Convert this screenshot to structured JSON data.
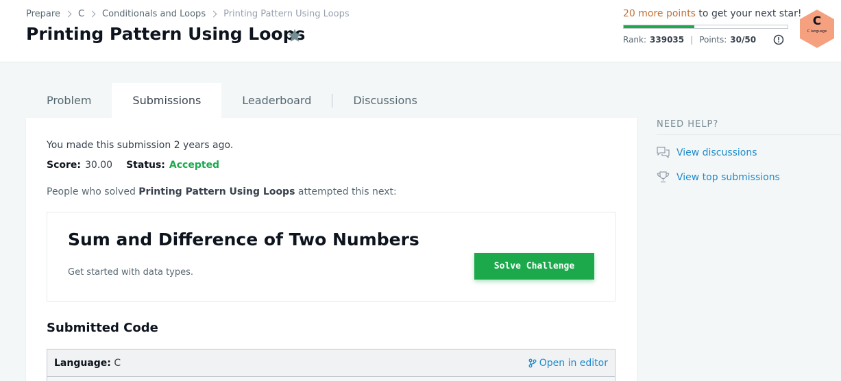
{
  "breadcrumb": [
    "Prepare",
    "C",
    "Conditionals and Loops",
    "Printing Pattern Using Loops"
  ],
  "page_title": "Printing Pattern Using Loops",
  "progress": {
    "points_needed": "20 more points",
    "points_suffix": " to get your next star!",
    "fraction": 0.43
  },
  "rank": {
    "label": "Rank:",
    "value": "339035"
  },
  "points": {
    "label": "Points:",
    "value": "30/50"
  },
  "badge": {
    "letter": "C",
    "sub": "C language"
  },
  "tabs": [
    {
      "label": "Problem"
    },
    {
      "label": "Submissions"
    },
    {
      "label": "Leaderboard"
    },
    {
      "label": "Discussions"
    }
  ],
  "submission": {
    "made": "You made this submission 2 years ago.",
    "score_label": "Score:",
    "score_value": "30.00",
    "status_label": "Status:",
    "status_value": "Accepted",
    "people_prefix": "People who solved ",
    "people_bold": "Printing Pattern Using Loops",
    "people_suffix": " attempted this next:"
  },
  "next_challenge": {
    "title": "Sum and Difference of Two Numbers",
    "subtitle": "Get started with data types.",
    "button": "Solve Challenge"
  },
  "code": {
    "heading": "Submitted Code",
    "language_label": "Language:",
    "language_value": "C",
    "open_editor": "Open in editor"
  },
  "help": {
    "heading": "NEED HELP?",
    "links": [
      "View discussions",
      "View top submissions"
    ]
  },
  "colors": {
    "accent_green": "#1ba94c",
    "link_blue": "#1f8acb",
    "points_orange": "#c0723a",
    "badge_orange": "#f5a180"
  },
  "icons": [
    "star-icon",
    "info-icon",
    "badge-hexagon-icon",
    "branch-icon",
    "chat-icon",
    "trophy-icon"
  ]
}
